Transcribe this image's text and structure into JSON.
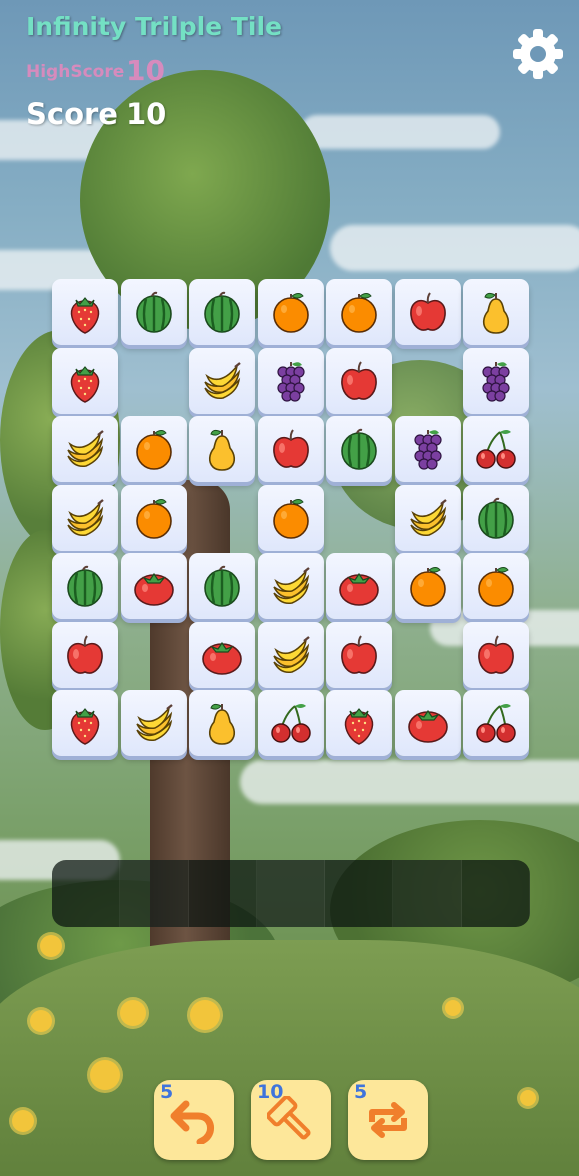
{
  "header": {
    "title": "Infinity Trilple Tile",
    "highscore_label": "HighScore",
    "highscore_value": "10",
    "score_label": "Score",
    "score_value": "10",
    "settings_icon": "gear-icon"
  },
  "board": {
    "tiles": [
      {
        "row": 0,
        "col": 0,
        "fruit": "strawberry"
      },
      {
        "row": 0,
        "col": 1,
        "fruit": "watermelon"
      },
      {
        "row": 0,
        "col": 2,
        "fruit": "watermelon"
      },
      {
        "row": 0,
        "col": 3,
        "fruit": "orange"
      },
      {
        "row": 0,
        "col": 4,
        "fruit": "orange"
      },
      {
        "row": 0,
        "col": 5,
        "fruit": "apple"
      },
      {
        "row": 0,
        "col": 6,
        "fruit": "pear"
      },
      {
        "row": 1,
        "col": 0,
        "fruit": "strawberry"
      },
      {
        "row": 1,
        "col": 2,
        "fruit": "banana"
      },
      {
        "row": 1,
        "col": 3,
        "fruit": "grape"
      },
      {
        "row": 1,
        "col": 4,
        "fruit": "apple"
      },
      {
        "row": 1,
        "col": 6,
        "fruit": "grape"
      },
      {
        "row": 2,
        "col": 0,
        "fruit": "banana"
      },
      {
        "row": 2,
        "col": 1,
        "fruit": "orange"
      },
      {
        "row": 2,
        "col": 2,
        "fruit": "pear"
      },
      {
        "row": 2,
        "col": 3,
        "fruit": "apple"
      },
      {
        "row": 2,
        "col": 4,
        "fruit": "watermelon"
      },
      {
        "row": 2,
        "col": 5,
        "fruit": "grape"
      },
      {
        "row": 2,
        "col": 6,
        "fruit": "cherry"
      },
      {
        "row": 3,
        "col": 0,
        "fruit": "banana"
      },
      {
        "row": 3,
        "col": 1,
        "fruit": "orange"
      },
      {
        "row": 3,
        "col": 3,
        "fruit": "orange"
      },
      {
        "row": 3,
        "col": 5,
        "fruit": "banana"
      },
      {
        "row": 3,
        "col": 6,
        "fruit": "watermelon"
      },
      {
        "row": 4,
        "col": 0,
        "fruit": "watermelon"
      },
      {
        "row": 4,
        "col": 1,
        "fruit": "tomato"
      },
      {
        "row": 4,
        "col": 2,
        "fruit": "watermelon"
      },
      {
        "row": 4,
        "col": 3,
        "fruit": "banana"
      },
      {
        "row": 4,
        "col": 4,
        "fruit": "tomato"
      },
      {
        "row": 4,
        "col": 5,
        "fruit": "orange"
      },
      {
        "row": 4,
        "col": 6,
        "fruit": "orange"
      },
      {
        "row": 5,
        "col": 0,
        "fruit": "apple"
      },
      {
        "row": 5,
        "col": 2,
        "fruit": "tomato"
      },
      {
        "row": 5,
        "col": 3,
        "fruit": "banana"
      },
      {
        "row": 5,
        "col": 4,
        "fruit": "apple"
      },
      {
        "row": 5,
        "col": 6,
        "fruit": "apple"
      },
      {
        "row": 6,
        "col": 0,
        "fruit": "strawberry"
      },
      {
        "row": 6,
        "col": 1,
        "fruit": "banana"
      },
      {
        "row": 6,
        "col": 2,
        "fruit": "pear"
      },
      {
        "row": 6,
        "col": 3,
        "fruit": "cherry"
      },
      {
        "row": 6,
        "col": 4,
        "fruit": "strawberry"
      },
      {
        "row": 6,
        "col": 5,
        "fruit": "tomato"
      },
      {
        "row": 6,
        "col": 6,
        "fruit": "cherry"
      }
    ]
  },
  "tray": {
    "slot_count": 7
  },
  "powerups": [
    {
      "name": "undo",
      "icon": "undo-icon",
      "count": "5"
    },
    {
      "name": "hammer",
      "icon": "hammer-icon",
      "count": "10"
    },
    {
      "name": "shuffle",
      "icon": "shuffle-icon",
      "count": "5"
    }
  ],
  "colors": {
    "title": "#74e0c4",
    "highscore": "#d68bbd",
    "score": "#ffffff",
    "button_bg": "#fde79a",
    "button_icon": "#f07f2c",
    "count_text": "#3f74dc"
  }
}
